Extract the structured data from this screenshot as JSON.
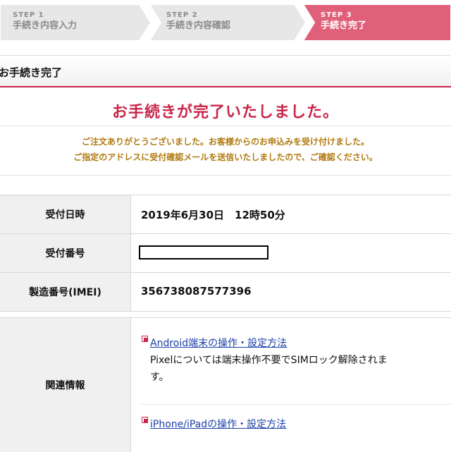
{
  "steps": [
    {
      "number": "STEP 1",
      "label": "手続き内容入力",
      "state": "inactive"
    },
    {
      "number": "STEP 2",
      "label": "手続き内容確認",
      "state": "inactive"
    },
    {
      "number": "STEP 3",
      "label": "手続き完了",
      "state": "active"
    }
  ],
  "colors": {
    "accent": "#c8264a",
    "active_step": "#e0607a",
    "inactive_step": "#e7e7e7",
    "notice_text": "#b07a10",
    "link": "#1a3fa8"
  },
  "section": {
    "title": "お手続き完了"
  },
  "completion": {
    "title": "お手続きが完了いたしました。",
    "notice_line1": "ご注文ありがとうございました。お客様からのお申込みを受け付けました。",
    "notice_line2": "ご指定のアドレスに受付確認メールを送信いたしましたので、ご確認ください。"
  },
  "info": {
    "received_at_label": "受付日時",
    "received_at_value": "2019年6月30日　12時50分",
    "receipt_number_label": "受付番号",
    "receipt_number_value": "",
    "imei_label": "製造番号(IMEI)",
    "imei_value": "356738087577396"
  },
  "related": {
    "label": "関連情報",
    "links": [
      {
        "text": "Android端末の操作・設定方法",
        "icon": "document-icon",
        "description_line1": "Pixelについては端末操作不要でSIMロック解除されま",
        "description_line2": "す。"
      },
      {
        "text": "iPhone/iPadの操作・設定方法",
        "icon": "document-icon"
      }
    ]
  }
}
